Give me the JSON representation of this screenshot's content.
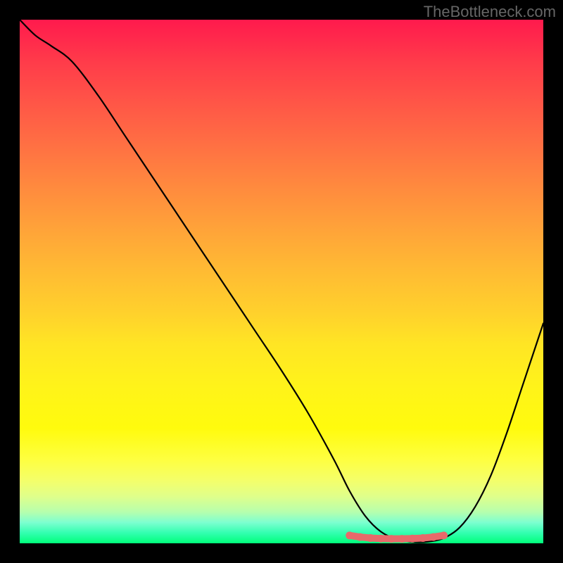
{
  "watermark": "TheBottleneck.com",
  "chart_data": {
    "type": "line",
    "title": "",
    "xlabel": "",
    "ylabel": "",
    "xlim": [
      0,
      100
    ],
    "ylim": [
      0,
      100
    ],
    "background_gradient": {
      "top": "#ff1a4d",
      "mid": "#ffe524",
      "bottom": "#00ff7b"
    },
    "series": [
      {
        "name": "bottleneck-curve",
        "color": "#000000",
        "x": [
          0,
          3,
          6,
          10,
          15,
          20,
          25,
          30,
          35,
          40,
          45,
          50,
          55,
          60,
          63,
          66,
          69,
          72,
          75,
          78,
          81,
          84,
          87,
          90,
          93,
          96,
          100
        ],
        "y": [
          100,
          97,
          95,
          92,
          85.5,
          78,
          70.5,
          63,
          55.5,
          48,
          40.5,
          33,
          25,
          16,
          10,
          5.2,
          2.2,
          0.8,
          0.25,
          0.3,
          1.0,
          3,
          7,
          13,
          21,
          30,
          42
        ]
      }
    ],
    "markers": {
      "name": "optimal-range",
      "color": "#e86a6a",
      "x": [
        63,
        65,
        67,
        69,
        71,
        73,
        75,
        77,
        79,
        81
      ],
      "y": [
        1.5,
        1.2,
        1.0,
        0.9,
        0.85,
        0.85,
        0.9,
        1.0,
        1.2,
        1.5
      ]
    }
  }
}
